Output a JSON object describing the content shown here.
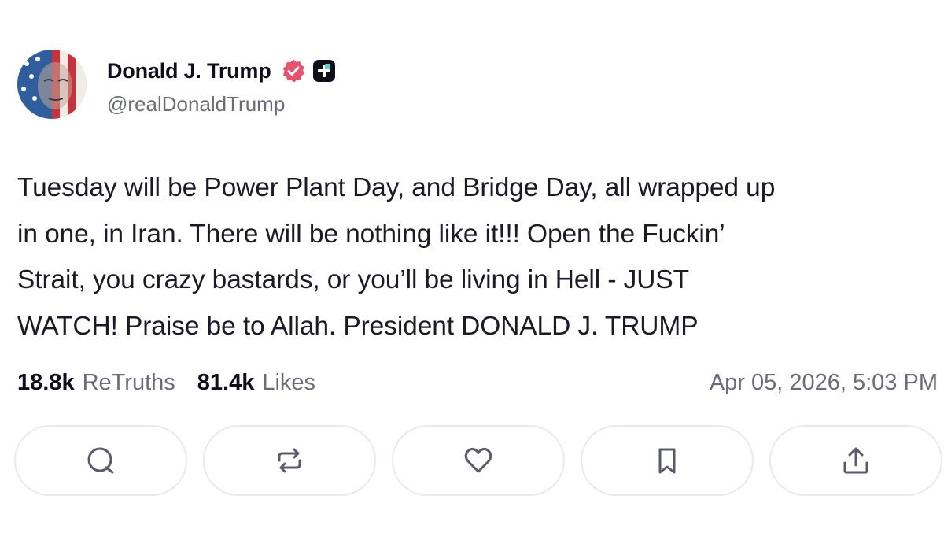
{
  "author": {
    "name": "Donald J. Trump",
    "handle": "@realDonaldTrump",
    "avatar_icon": "user-avatar-flag",
    "verified_icon": "verified-badge-icon",
    "verified_color": "#e8526b",
    "plus_icon": "truth-plus-icon"
  },
  "post": {
    "lines": [
      "Tuesday will be Power Plant Day, and Bridge Day, all wrapped up",
      "in one, in Iran. There will be nothing like it!!! Open the Fuckin’",
      "Strait, you crazy bastards, or you’ll be living in Hell - JUST",
      "WATCH! Praise be to Allah. President DONALD J. TRUMP"
    ]
  },
  "stats": {
    "retruths_count": "18.8k",
    "retruths_label": "ReTruths",
    "likes_count": "81.4k",
    "likes_label": "Likes",
    "timestamp": "Apr 05, 2026, 5:03 PM"
  },
  "actions": [
    {
      "name": "reply",
      "icon": "comment-icon"
    },
    {
      "name": "retruth",
      "icon": "repost-icon"
    },
    {
      "name": "like",
      "icon": "heart-icon"
    },
    {
      "name": "bookmark",
      "icon": "bookmark-icon"
    },
    {
      "name": "share",
      "icon": "share-icon"
    }
  ],
  "colors": {
    "text": "#0f0e1a",
    "muted": "#6b6b7a",
    "border": "#e9e9ef",
    "icon": "#5a5a6a"
  }
}
